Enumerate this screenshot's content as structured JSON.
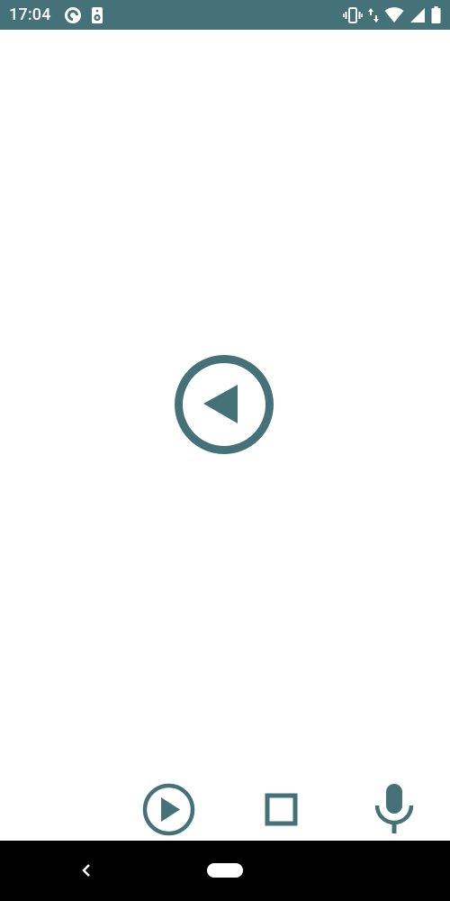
{
  "status_bar": {
    "time": "17:04",
    "left_icons": [
      "pocket-cast-icon",
      "speaker-icon"
    ],
    "right_icons": [
      "vibrate-icon",
      "data-arrows-icon",
      "wifi-icon",
      "signal-icon",
      "battery-icon"
    ]
  },
  "main": {
    "center_control": "back-circle-icon"
  },
  "controls": {
    "play": "play-circle-icon",
    "stop": "stop-square-icon",
    "mic": "microphone-icon"
  },
  "navigation": {
    "back": "nav-back-icon",
    "home": "nav-home-pill"
  },
  "colors": {
    "accent": "#457178",
    "status_bar_bg": "#457178",
    "nav_bar_bg": "#000000",
    "background": "#ffffff"
  }
}
